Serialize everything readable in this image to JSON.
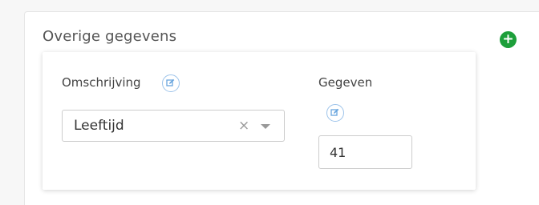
{
  "section": {
    "title": "Overige gegevens",
    "add_icon": "plus-circle-icon",
    "accent_color": "#1d9f3b"
  },
  "row": {
    "description_label": "Omschrijving",
    "value_label": "Gegeven",
    "edit_icon": "edit-icon",
    "select": {
      "selected": "Leeftijd",
      "clear_glyph": "×",
      "arrow_icon": "chevron-down-icon"
    },
    "value_input": {
      "value": "41"
    }
  }
}
